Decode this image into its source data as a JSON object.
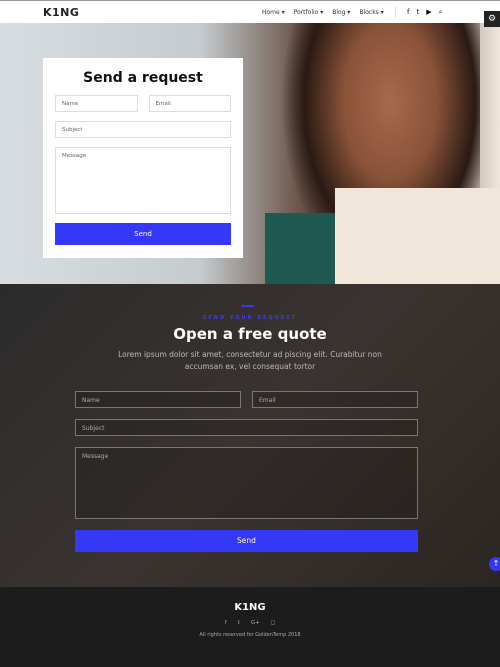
{
  "nav": {
    "logo": "K1NG",
    "menu": [
      "Home ▾",
      "Portfolio ▾",
      "Blog ▾",
      "Blocks ▾"
    ],
    "social": [
      "f",
      "t",
      "▶",
      "⌕"
    ]
  },
  "hero": {
    "title": "Send a request",
    "name_ph": "Name",
    "email_ph": "Email",
    "subject_ph": "Subject",
    "message_ph": "Message",
    "send": "Send"
  },
  "quote": {
    "kicker": "SEND YOUR REQUEST",
    "title": "Open a free quote",
    "desc": "Lorem ipsum dolor sit amet, consectetur ad piscing elit. Curabitur non accumsan ex, vel consequat tortor",
    "name_ph": "Name",
    "email_ph": "Email",
    "subject_ph": "Subject",
    "message_ph": "Message",
    "send": "Send"
  },
  "footer": {
    "logo": "K1NG",
    "social": [
      "f",
      "t",
      "G+",
      "◻"
    ],
    "copyright": "All rights reserved for GoldenTemp 2018"
  },
  "colors": {
    "accent": "#3538f5",
    "footer": "#1c1c1c"
  }
}
